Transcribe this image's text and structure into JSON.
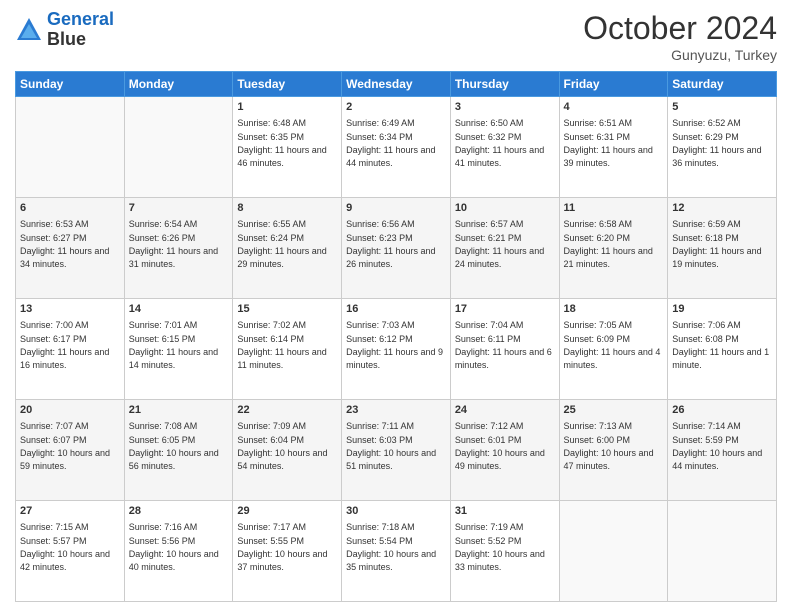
{
  "header": {
    "logo_line1": "General",
    "logo_line2": "Blue",
    "month_title": "October 2024",
    "subtitle": "Gunyuzu, Turkey"
  },
  "days_of_week": [
    "Sunday",
    "Monday",
    "Tuesday",
    "Wednesday",
    "Thursday",
    "Friday",
    "Saturday"
  ],
  "weeks": [
    [
      {
        "day": "",
        "sunrise": "",
        "sunset": "",
        "daylight": ""
      },
      {
        "day": "",
        "sunrise": "",
        "sunset": "",
        "daylight": ""
      },
      {
        "day": "1",
        "sunrise": "Sunrise: 6:48 AM",
        "sunset": "Sunset: 6:35 PM",
        "daylight": "Daylight: 11 hours and 46 minutes."
      },
      {
        "day": "2",
        "sunrise": "Sunrise: 6:49 AM",
        "sunset": "Sunset: 6:34 PM",
        "daylight": "Daylight: 11 hours and 44 minutes."
      },
      {
        "day": "3",
        "sunrise": "Sunrise: 6:50 AM",
        "sunset": "Sunset: 6:32 PM",
        "daylight": "Daylight: 11 hours and 41 minutes."
      },
      {
        "day": "4",
        "sunrise": "Sunrise: 6:51 AM",
        "sunset": "Sunset: 6:31 PM",
        "daylight": "Daylight: 11 hours and 39 minutes."
      },
      {
        "day": "5",
        "sunrise": "Sunrise: 6:52 AM",
        "sunset": "Sunset: 6:29 PM",
        "daylight": "Daylight: 11 hours and 36 minutes."
      }
    ],
    [
      {
        "day": "6",
        "sunrise": "Sunrise: 6:53 AM",
        "sunset": "Sunset: 6:27 PM",
        "daylight": "Daylight: 11 hours and 34 minutes."
      },
      {
        "day": "7",
        "sunrise": "Sunrise: 6:54 AM",
        "sunset": "Sunset: 6:26 PM",
        "daylight": "Daylight: 11 hours and 31 minutes."
      },
      {
        "day": "8",
        "sunrise": "Sunrise: 6:55 AM",
        "sunset": "Sunset: 6:24 PM",
        "daylight": "Daylight: 11 hours and 29 minutes."
      },
      {
        "day": "9",
        "sunrise": "Sunrise: 6:56 AM",
        "sunset": "Sunset: 6:23 PM",
        "daylight": "Daylight: 11 hours and 26 minutes."
      },
      {
        "day": "10",
        "sunrise": "Sunrise: 6:57 AM",
        "sunset": "Sunset: 6:21 PM",
        "daylight": "Daylight: 11 hours and 24 minutes."
      },
      {
        "day": "11",
        "sunrise": "Sunrise: 6:58 AM",
        "sunset": "Sunset: 6:20 PM",
        "daylight": "Daylight: 11 hours and 21 minutes."
      },
      {
        "day": "12",
        "sunrise": "Sunrise: 6:59 AM",
        "sunset": "Sunset: 6:18 PM",
        "daylight": "Daylight: 11 hours and 19 minutes."
      }
    ],
    [
      {
        "day": "13",
        "sunrise": "Sunrise: 7:00 AM",
        "sunset": "Sunset: 6:17 PM",
        "daylight": "Daylight: 11 hours and 16 minutes."
      },
      {
        "day": "14",
        "sunrise": "Sunrise: 7:01 AM",
        "sunset": "Sunset: 6:15 PM",
        "daylight": "Daylight: 11 hours and 14 minutes."
      },
      {
        "day": "15",
        "sunrise": "Sunrise: 7:02 AM",
        "sunset": "Sunset: 6:14 PM",
        "daylight": "Daylight: 11 hours and 11 minutes."
      },
      {
        "day": "16",
        "sunrise": "Sunrise: 7:03 AM",
        "sunset": "Sunset: 6:12 PM",
        "daylight": "Daylight: 11 hours and 9 minutes."
      },
      {
        "day": "17",
        "sunrise": "Sunrise: 7:04 AM",
        "sunset": "Sunset: 6:11 PM",
        "daylight": "Daylight: 11 hours and 6 minutes."
      },
      {
        "day": "18",
        "sunrise": "Sunrise: 7:05 AM",
        "sunset": "Sunset: 6:09 PM",
        "daylight": "Daylight: 11 hours and 4 minutes."
      },
      {
        "day": "19",
        "sunrise": "Sunrise: 7:06 AM",
        "sunset": "Sunset: 6:08 PM",
        "daylight": "Daylight: 11 hours and 1 minute."
      }
    ],
    [
      {
        "day": "20",
        "sunrise": "Sunrise: 7:07 AM",
        "sunset": "Sunset: 6:07 PM",
        "daylight": "Daylight: 10 hours and 59 minutes."
      },
      {
        "day": "21",
        "sunrise": "Sunrise: 7:08 AM",
        "sunset": "Sunset: 6:05 PM",
        "daylight": "Daylight: 10 hours and 56 minutes."
      },
      {
        "day": "22",
        "sunrise": "Sunrise: 7:09 AM",
        "sunset": "Sunset: 6:04 PM",
        "daylight": "Daylight: 10 hours and 54 minutes."
      },
      {
        "day": "23",
        "sunrise": "Sunrise: 7:11 AM",
        "sunset": "Sunset: 6:03 PM",
        "daylight": "Daylight: 10 hours and 51 minutes."
      },
      {
        "day": "24",
        "sunrise": "Sunrise: 7:12 AM",
        "sunset": "Sunset: 6:01 PM",
        "daylight": "Daylight: 10 hours and 49 minutes."
      },
      {
        "day": "25",
        "sunrise": "Sunrise: 7:13 AM",
        "sunset": "Sunset: 6:00 PM",
        "daylight": "Daylight: 10 hours and 47 minutes."
      },
      {
        "day": "26",
        "sunrise": "Sunrise: 7:14 AM",
        "sunset": "Sunset: 5:59 PM",
        "daylight": "Daylight: 10 hours and 44 minutes."
      }
    ],
    [
      {
        "day": "27",
        "sunrise": "Sunrise: 7:15 AM",
        "sunset": "Sunset: 5:57 PM",
        "daylight": "Daylight: 10 hours and 42 minutes."
      },
      {
        "day": "28",
        "sunrise": "Sunrise: 7:16 AM",
        "sunset": "Sunset: 5:56 PM",
        "daylight": "Daylight: 10 hours and 40 minutes."
      },
      {
        "day": "29",
        "sunrise": "Sunrise: 7:17 AM",
        "sunset": "Sunset: 5:55 PM",
        "daylight": "Daylight: 10 hours and 37 minutes."
      },
      {
        "day": "30",
        "sunrise": "Sunrise: 7:18 AM",
        "sunset": "Sunset: 5:54 PM",
        "daylight": "Daylight: 10 hours and 35 minutes."
      },
      {
        "day": "31",
        "sunrise": "Sunrise: 7:19 AM",
        "sunset": "Sunset: 5:52 PM",
        "daylight": "Daylight: 10 hours and 33 minutes."
      },
      {
        "day": "",
        "sunrise": "",
        "sunset": "",
        "daylight": ""
      },
      {
        "day": "",
        "sunrise": "",
        "sunset": "",
        "daylight": ""
      }
    ]
  ]
}
